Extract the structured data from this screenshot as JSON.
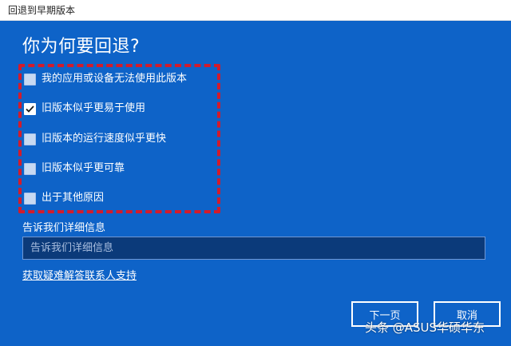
{
  "window": {
    "title": "回退到早期版本"
  },
  "dialog": {
    "heading": "你为何要回退?",
    "options": [
      {
        "label": "我的应用或设备无法使用此版本",
        "checked": false
      },
      {
        "label": "旧版本似乎更易于使用",
        "checked": true
      },
      {
        "label": "旧版本的运行速度似乎更快",
        "checked": false
      },
      {
        "label": "旧版本似乎更可靠",
        "checked": false
      },
      {
        "label": "出于其他原因",
        "checked": false
      }
    ],
    "details_label": "告诉我们详细信息",
    "details_placeholder": "告诉我们详细信息",
    "details_value": "",
    "help_link": "获取疑难解答联系人支持",
    "next_button": "下一页",
    "cancel_button": "取消"
  },
  "watermark": {
    "text": "头条 @ASUS华硕华东"
  },
  "colors": {
    "panel_background": "#0e63c8",
    "highlight_border": "#d31b2b",
    "input_background": "#0b3a7a"
  }
}
